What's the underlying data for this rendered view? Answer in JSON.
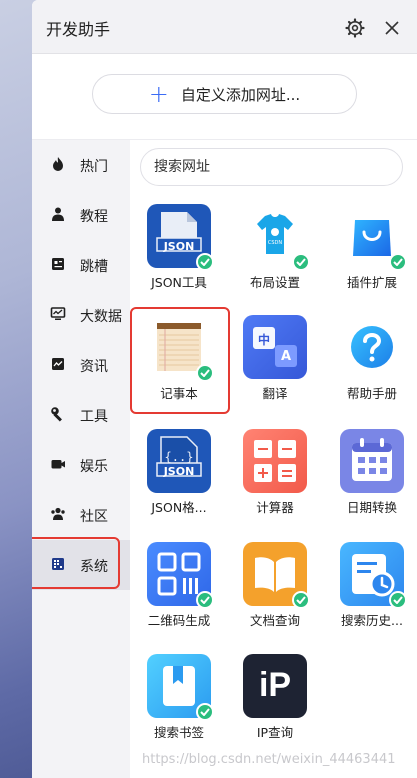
{
  "header": {
    "title": "开发助手"
  },
  "add_button": {
    "label": "自定义添加网址..."
  },
  "search": {
    "placeholder": "搜索网址"
  },
  "sidebar": {
    "items": [
      {
        "label": "热门",
        "icon": "fire-icon"
      },
      {
        "label": "教程",
        "icon": "person-icon"
      },
      {
        "label": "跳槽",
        "icon": "resume-icon"
      },
      {
        "label": "大数据",
        "icon": "monitor-icon"
      },
      {
        "label": "资讯",
        "icon": "news-icon"
      },
      {
        "label": "工具",
        "icon": "wrench-icon"
      },
      {
        "label": "娱乐",
        "icon": "video-icon"
      },
      {
        "label": "社区",
        "icon": "group-icon"
      },
      {
        "label": "系统",
        "icon": "grid-icon",
        "selected": true
      }
    ]
  },
  "tiles": [
    {
      "label": "JSON工具",
      "icon": "json-file-icon",
      "installed": true
    },
    {
      "label": "布局设置",
      "icon": "tshirt-icon",
      "installed": true
    },
    {
      "label": "插件扩展",
      "icon": "shopping-bag-icon",
      "installed": true
    },
    {
      "label": "记事本",
      "icon": "notepad-icon",
      "installed": true
    },
    {
      "label": "翻译",
      "icon": "translate-icon",
      "installed": false
    },
    {
      "label": "帮助手册",
      "icon": "help-icon",
      "installed": false
    },
    {
      "label": "JSON格...",
      "icon": "json-format-icon",
      "installed": false
    },
    {
      "label": "计算器",
      "icon": "calculator-icon",
      "installed": false
    },
    {
      "label": "日期转换",
      "icon": "calendar-icon",
      "installed": false
    },
    {
      "label": "二维码生成",
      "icon": "qrcode-icon",
      "installed": true
    },
    {
      "label": "文档查询",
      "icon": "book-icon",
      "installed": true
    },
    {
      "label": "搜索历史...",
      "icon": "history-icon",
      "installed": true
    },
    {
      "label": "搜索书签",
      "icon": "bookmark-icon",
      "installed": true
    },
    {
      "label": "IP查询",
      "icon": "ip-icon",
      "installed": false
    }
  ],
  "badge_text": {
    "json": "JSON",
    "csdn": "CSDN",
    "zh": "中",
    "a": "A",
    "ip": "iP"
  },
  "watermark": "https://blog.csdn.net/weixin_44463441",
  "colors": {
    "accent": "#3b6cf5",
    "installed_check": "#2bbd7e",
    "highlight_box": "#e43a32"
  }
}
